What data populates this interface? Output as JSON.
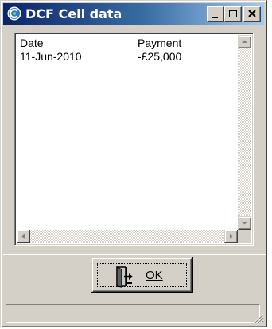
{
  "window": {
    "title": "DCF Cell data",
    "icon": "app-logo-icon",
    "controls": [
      "minimize-icon",
      "maximize-icon",
      "close-icon"
    ]
  },
  "list": {
    "columns": [
      "Date",
      "Payment"
    ],
    "rows": [
      {
        "date": "11-Jun-2010",
        "payment": "-£25,000"
      }
    ]
  },
  "ok_button": {
    "label": "OK",
    "icon": "door-exit-icon"
  },
  "statusbar": {
    "text": ""
  },
  "colors": {
    "titlebar_start": "#0a246a",
    "titlebar_end": "#a6caf0",
    "face": "#d4d0c8"
  }
}
